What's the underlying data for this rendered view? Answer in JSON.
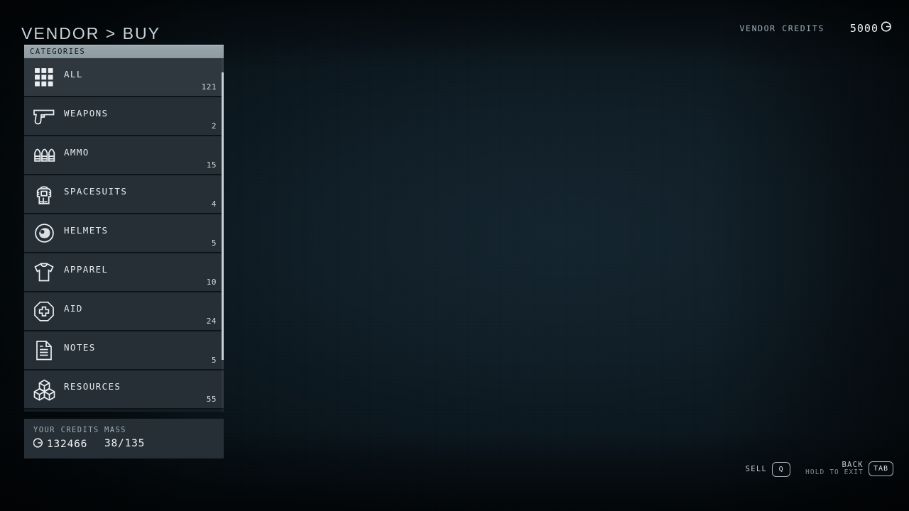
{
  "header": {
    "title": "VENDOR > BUY",
    "vendor_credits_label": "VENDOR CREDITS",
    "vendor_credits_value": "5000",
    "credit_icon": "credit-icon"
  },
  "categories_panel": {
    "header_label": "CATEGORIES",
    "items": [
      {
        "label": "ALL",
        "count": "121",
        "icon": "grid-icon",
        "selected": true
      },
      {
        "label": "WEAPONS",
        "count": "2",
        "icon": "pistol-icon",
        "selected": false
      },
      {
        "label": "AMMO",
        "count": "15",
        "icon": "bullets-icon",
        "selected": false
      },
      {
        "label": "SPACESUITS",
        "count": "4",
        "icon": "spacesuit-icon",
        "selected": false
      },
      {
        "label": "HELMETS",
        "count": "5",
        "icon": "helmet-icon",
        "selected": false
      },
      {
        "label": "APPAREL",
        "count": "10",
        "icon": "tshirt-icon",
        "selected": false
      },
      {
        "label": "AID",
        "count": "24",
        "icon": "medkit-icon",
        "selected": false
      },
      {
        "label": "NOTES",
        "count": "5",
        "icon": "note-icon",
        "selected": false
      },
      {
        "label": "RESOURCES",
        "count": "55",
        "icon": "cubes-icon",
        "selected": false
      }
    ]
  },
  "player_stats": {
    "credits_label": "YOUR CREDITS",
    "credits_value": "132466",
    "mass_label": "MASS",
    "mass_value": "38/135"
  },
  "control_hints": [
    {
      "label": "SELL",
      "sub": "",
      "key": "Q"
    },
    {
      "label": "BACK",
      "sub": "HOLD TO EXIT",
      "key": "TAB"
    }
  ],
  "colors": {
    "background": "#0b171e",
    "panel_row": "#272f36",
    "panel_row_selected": "#2f383f",
    "header_bar": "#9aa7ae",
    "text_primary": "#e4ebef",
    "text_muted": "#9eacb4",
    "icon_stroke": "#e9eff2"
  }
}
